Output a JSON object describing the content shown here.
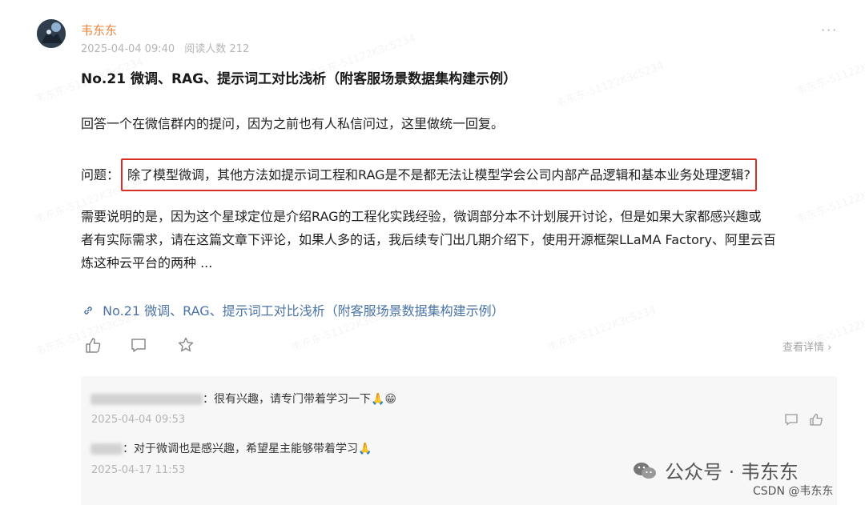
{
  "post": {
    "author": "韦东东",
    "date": "2025-04-04 09:40",
    "readers_label": "阅读人数 212",
    "more_label": "···",
    "title": "No.21 微调、RAG、提示词工对比浅析（附客服场景数据集构建示例）",
    "para1": "回答一个在微信群内的提问，因为之前也有人私信问过，这里做统一回复。",
    "question_label": "问题：",
    "question_text": "除了模型微调，其他方法如提示词工程和RAG是不是都无法让模型学会公司内部产品逻辑和基本业务处理逻辑?",
    "para3_line1": "需要说明的是，因为这个星球定位是介绍RAG的工程化实践经验，微调部分本不计划展开讨论，但是如果大家都感兴趣或",
    "para3_line2": "者有实际需求，请在这篇文章下评论，如果人多的话，我后续专门出几期介绍下，使用开源框架LLaMA Factory、阿里云百",
    "para3_line3": "炼这种云平台的两种 ...",
    "link_text": "No.21 微调、RAG、提示词工对比浅析（附客服场景数据集构建示例）",
    "view_detail": "查看详情",
    "highlight_color": "#d93025",
    "author_color": "#e8833a",
    "link_color": "#4a73a8"
  },
  "comments": [
    {
      "text": "：很有兴趣，请专门带着学习一下",
      "emoji": "🙏😁",
      "date": "2025-04-04 09:53"
    },
    {
      "text": "：对于微调也是感兴趣，希望星主能够带着学习",
      "emoji": "🙏",
      "date": "2025-04-17 11:53"
    }
  ],
  "footer": {
    "brand": "公众号 · 韦东东",
    "csdn": "CSDN @韦东东"
  },
  "watermark_text": "韦东东-51122K3c5234"
}
